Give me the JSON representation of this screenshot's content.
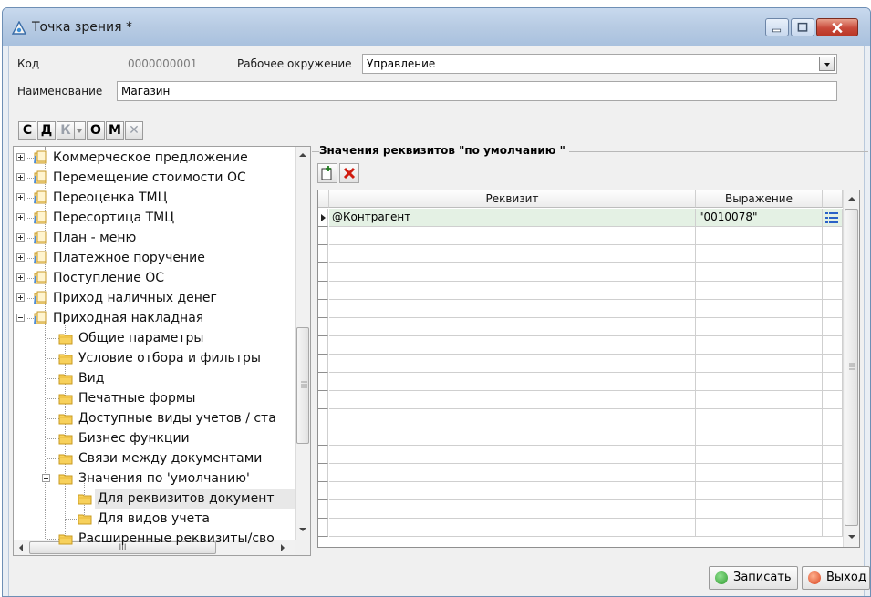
{
  "window": {
    "title": "Точка зрения *",
    "buttons": {
      "minimize": "minimize",
      "maximize": "maximize",
      "close": "close"
    }
  },
  "header": {
    "code_label": "Код",
    "code_value": "0000000001",
    "workspace_label": "Рабочее окружение",
    "workspace_value": "Управление",
    "name_label": "Наименование",
    "name_value": "Магазин"
  },
  "toolbar": {
    "buttons": [
      "С",
      "Д",
      "К",
      "О",
      "М",
      "✕"
    ]
  },
  "tree": {
    "items": [
      {
        "label": "Коммерческое предложение",
        "level": 1,
        "icon": "doc-icon",
        "expander": "plus"
      },
      {
        "label": "Перемещение стоимости ОС",
        "level": 1,
        "icon": "doc-icon",
        "expander": "plus"
      },
      {
        "label": "Переоценка ТМЦ",
        "level": 1,
        "icon": "doc-icon",
        "expander": "plus"
      },
      {
        "label": "Пересортица ТМЦ",
        "level": 1,
        "icon": "doc-icon",
        "expander": "plus"
      },
      {
        "label": "План - меню",
        "level": 1,
        "icon": "doc-icon",
        "expander": "plus"
      },
      {
        "label": "Платежное поручение",
        "level": 1,
        "icon": "doc-icon",
        "expander": "plus"
      },
      {
        "label": "Поступление ОС",
        "level": 1,
        "icon": "doc-icon",
        "expander": "plus"
      },
      {
        "label": "Приход наличных денег",
        "level": 1,
        "icon": "doc-icon",
        "expander": "plus"
      },
      {
        "label": "Приходная накладная",
        "level": 1,
        "icon": "doc-icon",
        "expander": "minus"
      },
      {
        "label": "Общие параметры",
        "level": 2,
        "icon": "folder-icon",
        "expander": "none"
      },
      {
        "label": "Условие отбора и фильтры",
        "level": 2,
        "icon": "folder-icon",
        "expander": "none"
      },
      {
        "label": "Вид",
        "level": 2,
        "icon": "folder-icon",
        "expander": "none"
      },
      {
        "label": "Печатные формы",
        "level": 2,
        "icon": "folder-icon",
        "expander": "none"
      },
      {
        "label": "Доступные виды учетов / ста",
        "level": 2,
        "icon": "folder-icon",
        "expander": "none"
      },
      {
        "label": "Бизнес функции",
        "level": 2,
        "icon": "folder-icon",
        "expander": "none"
      },
      {
        "label": "Связи между документами",
        "level": 2,
        "icon": "folder-icon",
        "expander": "none"
      },
      {
        "label": "Значения по 'умолчанию'",
        "level": 2,
        "icon": "folder-icon",
        "expander": "minus"
      },
      {
        "label": "Для реквизитов документ",
        "level": 3,
        "icon": "folder-icon",
        "expander": "none",
        "selected": true
      },
      {
        "label": "Для видов учета",
        "level": 3,
        "icon": "folder-icon",
        "expander": "none"
      },
      {
        "label": "Расширенные реквизиты/сво",
        "level": 2,
        "icon": "folder-icon",
        "expander": "none"
      }
    ],
    "hscroll_grip": "III"
  },
  "panel": {
    "group_title": "Значения реквизитов \"по умолчанию \"",
    "add_icon": "add-row-icon",
    "delete_icon": "delete-icon"
  },
  "grid": {
    "columns": [
      "Реквизит",
      "Выражение"
    ],
    "rows": [
      {
        "attribute": "@Контрагент",
        "expression": "\"0010078\""
      }
    ]
  },
  "footer": {
    "save_label": "Записать",
    "exit_label": "Выход"
  },
  "colors": {
    "selected_row": "#e4f1e4",
    "tree_selected": "#e8e8e8",
    "save_icon": "#3aa63a",
    "exit_icon": "#d8431f"
  }
}
